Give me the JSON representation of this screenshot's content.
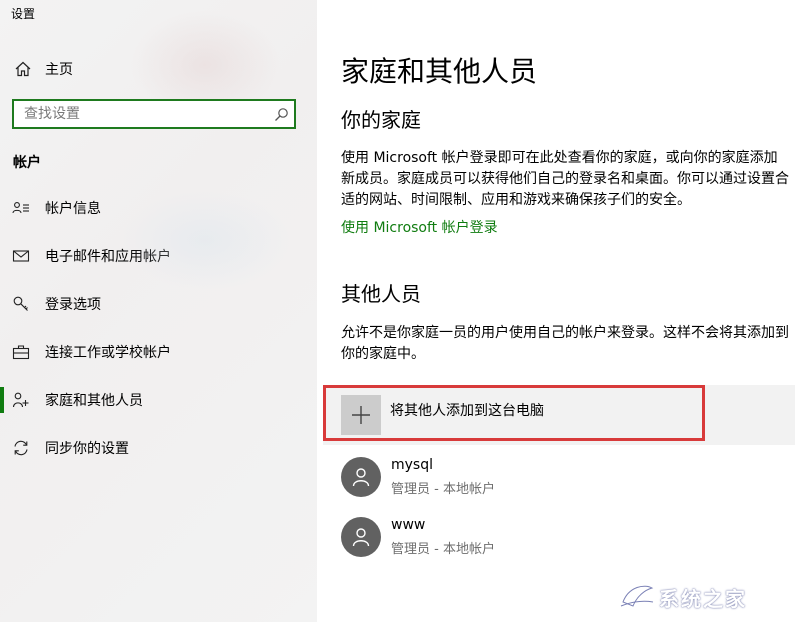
{
  "window": {
    "title": "设置"
  },
  "sidebar": {
    "home_label": "主页",
    "search_placeholder": "查找设置",
    "section_title": "帐户",
    "items": [
      {
        "label": "帐户信息",
        "icon": "account-info-icon"
      },
      {
        "label": "电子邮件和应用帐户",
        "icon": "mail-icon"
      },
      {
        "label": "登录选项",
        "icon": "key-icon"
      },
      {
        "label": "连接工作或学校帐户",
        "icon": "briefcase-icon"
      },
      {
        "label": "家庭和其他人员",
        "icon": "people-icon",
        "active": true
      },
      {
        "label": "同步你的设置",
        "icon": "sync-icon"
      }
    ]
  },
  "main": {
    "page_title": "家庭和其他人员",
    "family": {
      "heading": "你的家庭",
      "description": "使用 Microsoft 帐户登录即可在此处查看你的家庭，或向你的家庭添加新成员。家庭成员可以获得他们自己的登录名和桌面。你可以通过设置合适的网站、时间限制、应用和游戏来确保孩子们的安全。",
      "link": "使用 Microsoft 帐户登录"
    },
    "others": {
      "heading": "其他人员",
      "description": "允许不是你家庭一员的用户使用自己的帐户来登录。这样不会将其添加到你的家庭中。",
      "add_label": "将其他人添加到这台电脑",
      "users": [
        {
          "name": "mysql",
          "role": "管理员 - 本地帐户"
        },
        {
          "name": "www",
          "role": "管理员 - 本地帐户"
        }
      ]
    }
  },
  "watermark": {
    "text": "系统之家"
  },
  "colors": {
    "accent": "#107c10",
    "highlight_frame": "#d83a3a",
    "sidebar_bg": "#f3f3f3",
    "avatar_bg": "#616161"
  }
}
